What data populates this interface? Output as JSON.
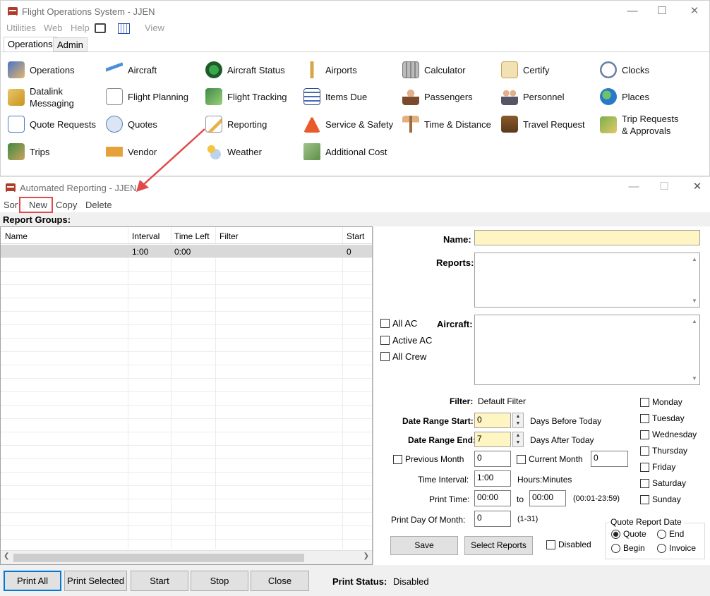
{
  "main_window": {
    "title": "Flight Operations System - JJEN",
    "menu": [
      "Utilities",
      "Web",
      "Help",
      "View"
    ],
    "tabs": [
      "Operations",
      "Admin"
    ],
    "ops_items": [
      {
        "label": "Operations",
        "icon": "operations-icon"
      },
      {
        "label": "Aircraft",
        "icon": "airplane-icon"
      },
      {
        "label": "Aircraft Status",
        "icon": "radar-icon"
      },
      {
        "label": "Airports",
        "icon": "control-tower-icon"
      },
      {
        "label": "Calculator",
        "icon": "calculator-icon"
      },
      {
        "label": "Certify",
        "icon": "certificate-icon"
      },
      {
        "label": "Clocks",
        "icon": "clock-icon"
      },
      {
        "label": "Datalink\nMessaging",
        "icon": "envelope-icon"
      },
      {
        "label": "Flight Planning",
        "icon": "checklist-icon"
      },
      {
        "label": "Flight Tracking",
        "icon": "map-tracking-icon"
      },
      {
        "label": "Items Due",
        "icon": "list-icon"
      },
      {
        "label": "Passengers",
        "icon": "passengers-icon"
      },
      {
        "label": "Personnel",
        "icon": "personnel-icon"
      },
      {
        "label": "Places",
        "icon": "globe-icon"
      },
      {
        "label": "Quote Requests",
        "icon": "document-icon"
      },
      {
        "label": "Quotes",
        "icon": "speech-bubble-icon"
      },
      {
        "label": "Reporting",
        "icon": "report-pencil-icon"
      },
      {
        "label": "Service & Safety",
        "icon": "warning-sign-icon"
      },
      {
        "label": "Time & Distance",
        "icon": "signpost-icon"
      },
      {
        "label": "Travel Request",
        "icon": "suitcase-icon"
      },
      {
        "label": "Trip Requests\n& Approvals",
        "icon": "approval-check-icon"
      },
      {
        "label": "Trips",
        "icon": "map-icon"
      },
      {
        "label": "Vendor",
        "icon": "truck-icon"
      },
      {
        "label": "Weather",
        "icon": "weather-icon"
      },
      {
        "label": "Additional Cost",
        "icon": "money-icon"
      }
    ]
  },
  "report_window": {
    "title": "Automated Reporting - JJEN",
    "menu": [
      "Sort",
      "New",
      "Copy",
      "Delete"
    ],
    "group_label": "Report Groups:",
    "grid": {
      "columns": [
        "Name",
        "Interval",
        "Time Left",
        "Filter",
        "Start"
      ],
      "rows": [
        [
          "",
          "1:00",
          "0:00",
          "",
          "0"
        ]
      ]
    },
    "form": {
      "name_label": "Name:",
      "name_value": "",
      "reports_label": "Reports:",
      "aircraft_label": "Aircraft:",
      "all_ac": "All AC",
      "active_ac": "Active AC",
      "all_crew": "All Crew",
      "filter_label": "Filter:",
      "filter_value": "Default Filter",
      "date_start_label": "Date Range Start:",
      "date_start_value": "0",
      "days_before": "Days Before Today",
      "date_end_label": "Date Range End:",
      "date_end_value": "7",
      "days_after": "Days After Today",
      "prev_month": "Previous Month",
      "prev_month_value": "0",
      "curr_month": "Current Month",
      "curr_month_value": "0",
      "time_interval_label": "Time Interval:",
      "time_interval_value": "1:00",
      "hours_minutes": "Hours:Minutes",
      "print_time_label": "Print Time:",
      "print_time_from": "00:00",
      "to_label": "to",
      "print_time_to": "00:00",
      "print_time_range": "(00:01-23:59)",
      "print_day_label": "Print Day Of Month:",
      "print_day_value": "0",
      "print_day_range": "(1-31)",
      "days": [
        "Monday",
        "Tuesday",
        "Wednesday",
        "Thursday",
        "Friday",
        "Saturday",
        "Sunday"
      ],
      "quote_group_title": "Quote Report Date",
      "quote_options": [
        "Quote",
        "End",
        "Begin",
        "Invoice"
      ],
      "disabled_label": "Disabled",
      "save": "Save",
      "select_reports": "Select Reports"
    },
    "footer": {
      "buttons": [
        "Print All",
        "Print Selected",
        "Start",
        "Stop",
        "Close"
      ],
      "status_label": "Print Status:",
      "status_value": "Disabled"
    }
  },
  "colors": {
    "annotation_red": "#e04a4a",
    "input_yellow": "#fff5c2",
    "focus_blue": "#0078d7"
  }
}
